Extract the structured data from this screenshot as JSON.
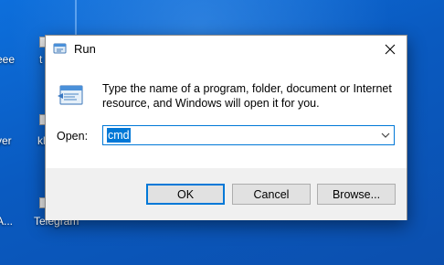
{
  "desktop": {
    "labels": [
      {
        "text": "eee"
      },
      {
        "text": "t"
      },
      {
        "text": "yer"
      },
      {
        "text": "kl"
      },
      {
        "text": "A..."
      },
      {
        "text": "Telegram"
      }
    ]
  },
  "dialog": {
    "title": "Run",
    "description": "Type the name of a program, folder, document or Internet resource, and Windows will open it for you.",
    "open_label": "Open:",
    "open_value": "cmd",
    "buttons": {
      "ok": "OK",
      "cancel": "Cancel",
      "browse": "Browse..."
    }
  },
  "colors": {
    "accent": "#0078d7",
    "desktop": "#0a5fc4",
    "footer": "#f0f0f0"
  },
  "icons": {
    "title": "run-icon",
    "close": "close-icon",
    "dropdown": "chevron-down-icon"
  }
}
